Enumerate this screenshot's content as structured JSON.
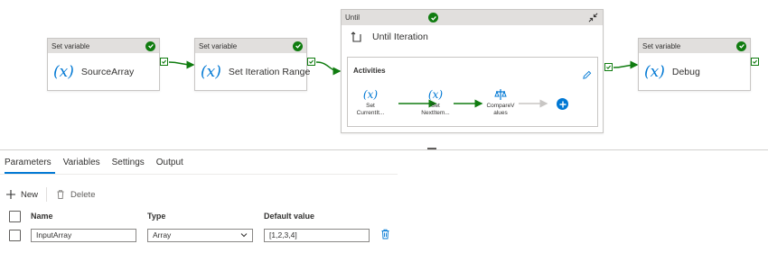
{
  "pipeline": {
    "activities": [
      {
        "type_label": "Set variable",
        "name": "SourceArray",
        "icon": "fx-icon",
        "status": "success"
      },
      {
        "type_label": "Set variable",
        "name": "Set Iteration Range",
        "icon": "fx-icon",
        "status": "success"
      },
      {
        "type_label": "Set variable",
        "name": "Debug",
        "icon": "fx-icon",
        "status": "success"
      }
    ],
    "until": {
      "type_label": "Until",
      "name": "Until Iteration",
      "status": "success",
      "activities_label": "Activities",
      "inner": [
        {
          "icon": "fx-icon",
          "name_line1": "Set",
          "name_line2": "CurrentIt..."
        },
        {
          "icon": "fx-icon",
          "name_line1": "Set",
          "name_line2": "NextItem..."
        },
        {
          "icon": "compare-icon",
          "name_line1": "CompareV",
          "name_line2": "alues"
        }
      ]
    },
    "fx_symbol": "(x)"
  },
  "tabs": [
    {
      "label": "Parameters",
      "active": true
    },
    {
      "label": "Variables",
      "active": false
    },
    {
      "label": "Settings",
      "active": false
    },
    {
      "label": "Output",
      "active": false
    }
  ],
  "toolbar": {
    "new_label": "New",
    "delete_label": "Delete"
  },
  "grid": {
    "columns": {
      "name": "Name",
      "type": "Type",
      "default": "Default value"
    },
    "rows": [
      {
        "name": "InputArray",
        "type": "Array",
        "default": "[1,2,3,4]"
      }
    ]
  },
  "colors": {
    "accent": "#0078d4",
    "success": "#107c10",
    "header_bg": "#e1dfdd"
  }
}
